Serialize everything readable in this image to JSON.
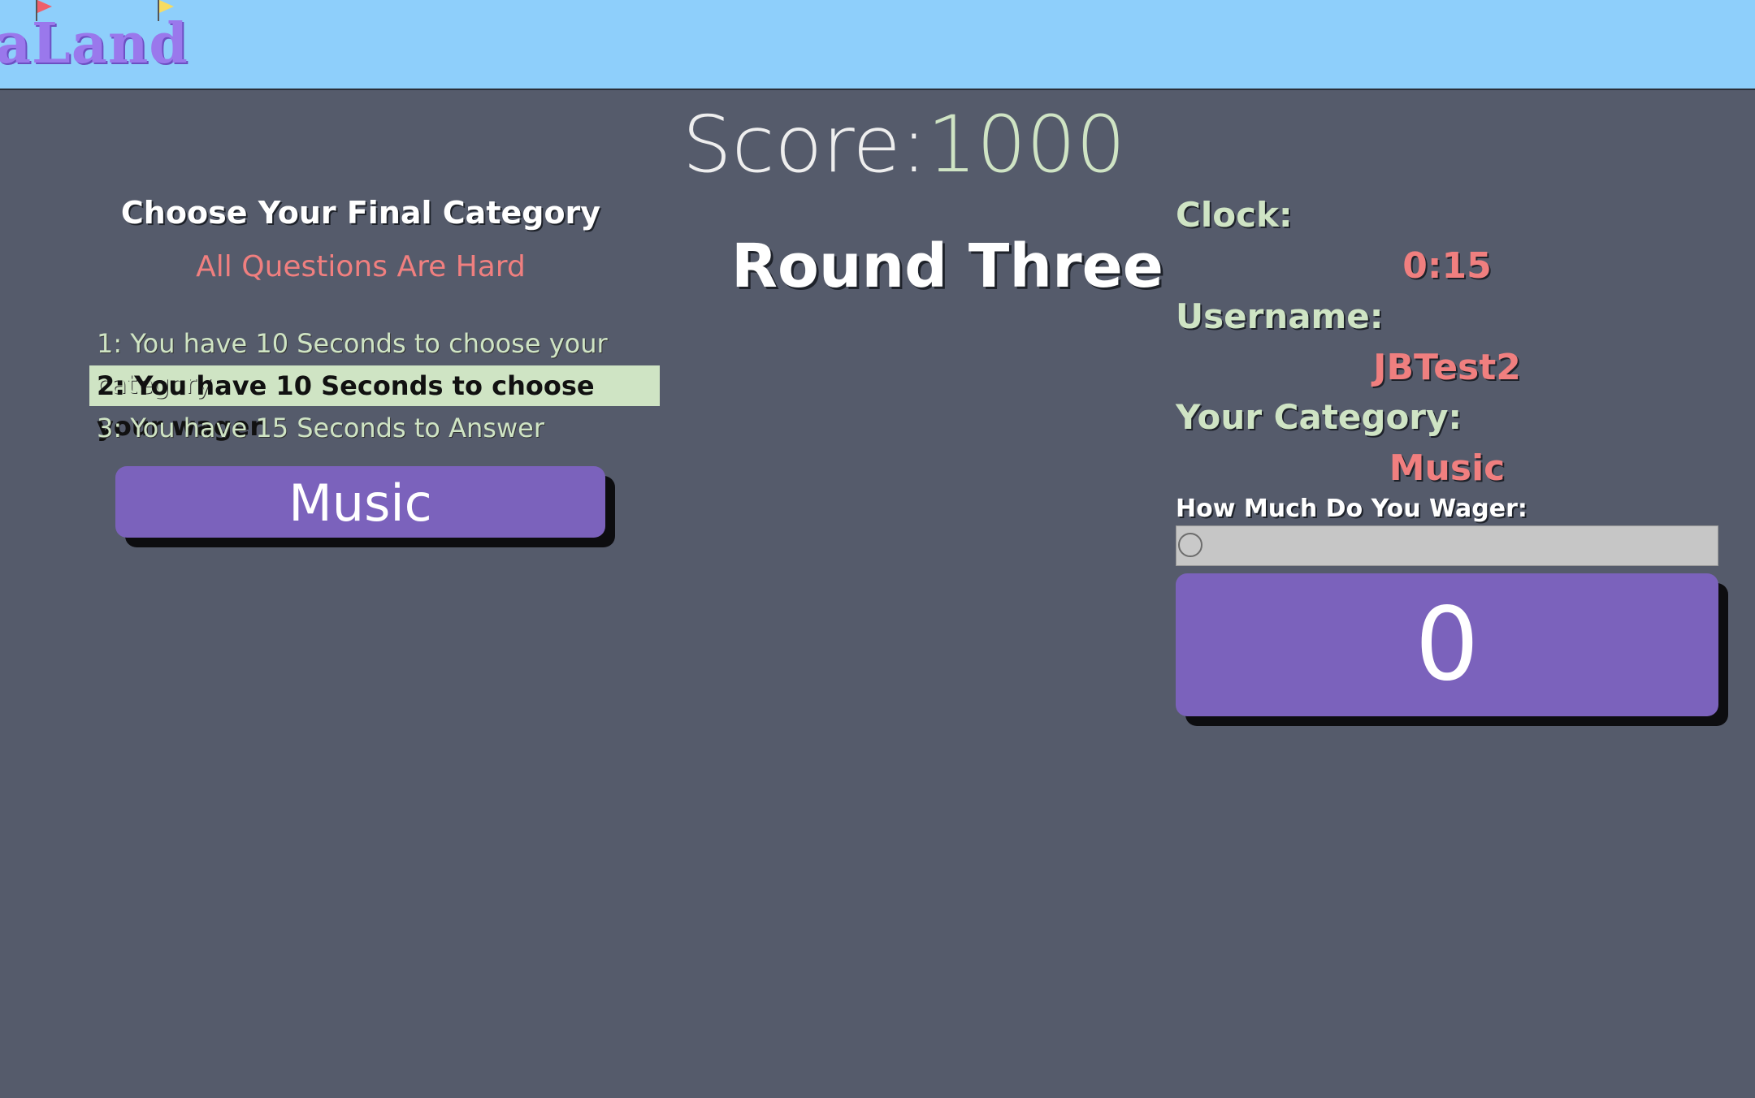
{
  "header": {
    "logo_text": "aLand"
  },
  "score": {
    "label": "Score:",
    "value": "1000"
  },
  "round": {
    "title": "Round Three"
  },
  "left_panel": {
    "title": "Choose Your Final Category",
    "subtitle": "All Questions Are Hard",
    "rules": [
      "1: You have 10 Seconds to choose your category",
      "2: You have 10 Seconds to choose your wager",
      "3: You have 15 Seconds to Answer"
    ],
    "active_rule_index": 1,
    "category_button": "Music"
  },
  "right_panel": {
    "clock_label": "Clock:",
    "clock_value": "0:15",
    "username_label": "Username:",
    "username_value": "JBTest2",
    "category_label": "Your Category:",
    "category_value": "Music",
    "wager_label": "How Much Do You Wager:",
    "wager_slider_value": 0,
    "wager_display": "0"
  },
  "colors": {
    "background": "#555b6b",
    "header": "#8ecffb",
    "accent_purple": "#7b62bc",
    "highlight_green": "#cfe4c4",
    "value_red": "#f07f7f"
  }
}
